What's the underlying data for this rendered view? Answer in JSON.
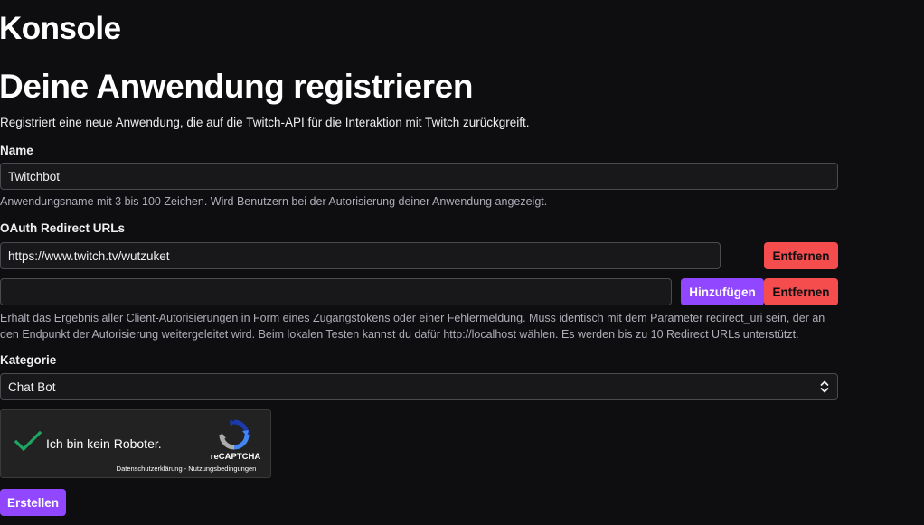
{
  "header": {
    "console_title": "Konsole",
    "page_title": "Deine Anwendung registrieren",
    "subtitle": "Registriert eine neue Anwendung, die auf die Twitch-API für die Interaktion mit Twitch zurückgreift."
  },
  "name_field": {
    "label": "Name",
    "value": "Twitchbot",
    "hint": "Anwendungsname mit 3 bis 100 Zeichen. Wird Benutzern bei der Autorisierung deiner Anwendung angezeigt."
  },
  "redirect": {
    "label": "OAuth Redirect URLs",
    "urls": [
      "https://www.twitch.tv/wutzuket",
      ""
    ],
    "remove_label": "Entfernen",
    "add_label": "Hinzufügen",
    "hint": "Erhält das Ergebnis aller Client-Autorisierungen in Form eines Zugangstokens oder einer Fehlermeldung. Muss identisch mit dem Parameter redirect_uri sein, der an den Endpunkt der Autorisierung weitergeleitet wird. Beim lokalen Testen kannst du dafür http://localhost wählen. Es werden bis zu 10 Redirect URLs unterstützt."
  },
  "category": {
    "label": "Kategorie",
    "selected": "Chat Bot"
  },
  "captcha": {
    "label": "Ich bin kein Roboter.",
    "brand": "reCAPTCHA",
    "links": "Datenschutzerklärung - Nutzungsbedingungen",
    "checked": true
  },
  "submit_label": "Erstellen",
  "colors": {
    "background": "#0e0e10",
    "accent": "#9147ff",
    "danger": "#f54d4d",
    "check": "#1fa463"
  },
  "icons": {
    "select_arrows": "chevron-up-down-icon",
    "captcha_check": "checkmark-icon",
    "captcha_logo": "recaptcha-logo-icon"
  }
}
